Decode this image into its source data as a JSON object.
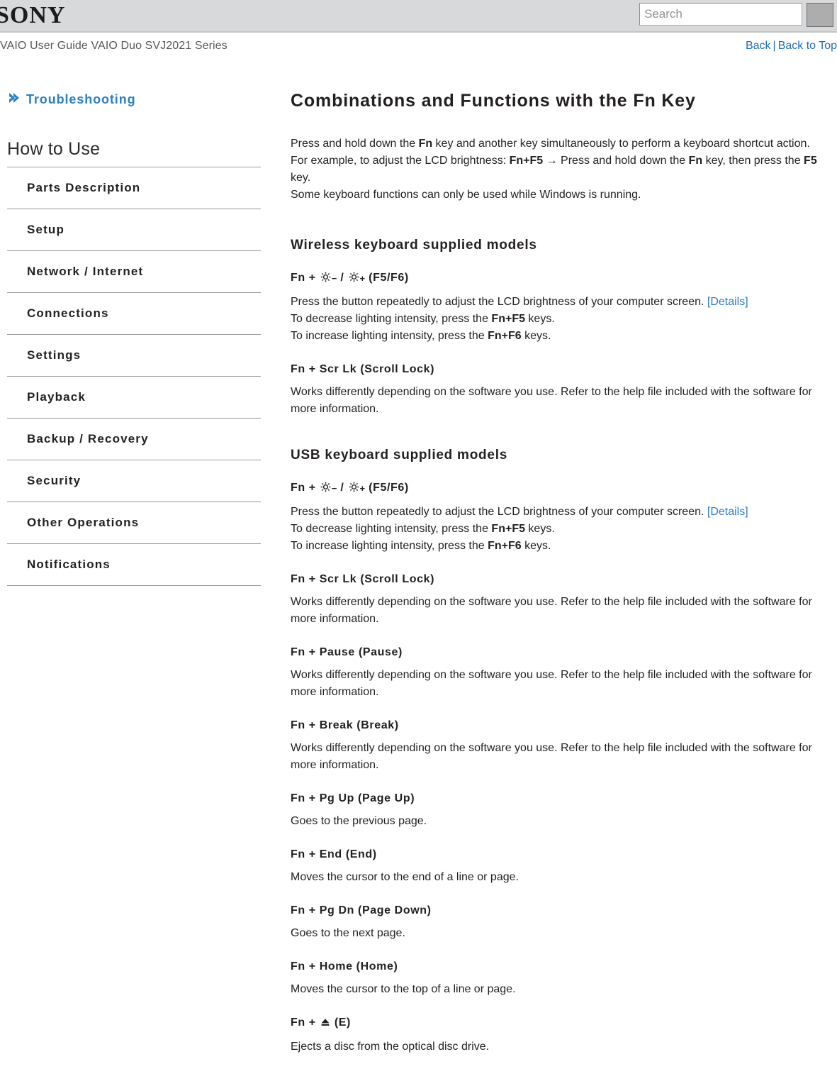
{
  "header": {
    "logo_text": "SONY",
    "search_placeholder": "Search",
    "search_value": "",
    "search_button_label": "",
    "guide_title": "VAIO User Guide VAIO Duo SVJ2021 Series",
    "back_label": "Back",
    "link_separator": "|",
    "back_to_top_label": "Back to Top"
  },
  "colors": {
    "link_blue": "#2e7ec4",
    "header_link_blue": "#1f6fb6",
    "header_gray": "#d8d9da",
    "text": "#231f20",
    "rule": "#9a9a9a"
  },
  "sidebar": {
    "breadcrumb": {
      "icon": "chevron-right-icon",
      "label": "Troubleshooting"
    },
    "section_title": "How to Use",
    "items": [
      {
        "label": "Parts Description"
      },
      {
        "label": "Setup"
      },
      {
        "label": "Network / Internet"
      },
      {
        "label": "Connections"
      },
      {
        "label": "Settings"
      },
      {
        "label": "Playback"
      },
      {
        "label": "Backup / Recovery"
      },
      {
        "label": "Security"
      },
      {
        "label": "Other Operations"
      },
      {
        "label": "Notifications"
      }
    ]
  },
  "main": {
    "title": "Combinations and Functions with the Fn Key",
    "intro": {
      "line1_a": "Press and hold down the ",
      "line1_fn": "Fn",
      "line1_b": " key and another key simultaneously to perform a keyboard shortcut action.",
      "line2_a": "For example, to adjust the LCD brightness: ",
      "line2_combo": "Fn+F5",
      "line2_b": " → Press and hold down the ",
      "line2_fn": "Fn",
      "line2_c": " key, then press the ",
      "line2_f5": "F5",
      "line2_d": " key.",
      "line3": "Some keyboard functions can only be used while Windows is running."
    },
    "sections": [
      {
        "heading": "Wireless keyboard supplied models",
        "entries": [
          {
            "type": "brightness",
            "prefix": "Fn + ",
            "icon_minus": "brightness-down-icon",
            "icon_minus_sign": "−",
            "separator": " / ",
            "icon_plus": "brightness-up-icon",
            "icon_plus_sign": "+",
            "suffix": " (F5/F6)",
            "body_a": "Press the button repeatedly to adjust the LCD brightness of your computer screen. ",
            "details_label": "[Details]",
            "body_b": "To decrease lighting intensity, press the ",
            "body_b_keys": "Fn+F5",
            "body_b_end": " keys.",
            "body_c": "To increase lighting intensity, press the ",
            "body_c_keys": "Fn+F6",
            "body_c_end": " keys."
          },
          {
            "type": "plain",
            "heading": "Fn + Scr Lk (Scroll Lock)",
            "body": "Works differently depending on the software you use. Refer to the help file included with the software for more information."
          }
        ]
      },
      {
        "heading": "USB keyboard supplied models",
        "entries": [
          {
            "type": "brightness",
            "prefix": "Fn + ",
            "icon_minus": "brightness-down-icon",
            "icon_minus_sign": "−",
            "separator": " / ",
            "icon_plus": "brightness-up-icon",
            "icon_plus_sign": "+",
            "suffix": " (F5/F6)",
            "body_a": "Press the button repeatedly to adjust the LCD brightness of your computer screen. ",
            "details_label": "[Details]",
            "body_b": "To decrease lighting intensity, press the ",
            "body_b_keys": "Fn+F5",
            "body_b_end": " keys.",
            "body_c": "To increase lighting intensity, press the ",
            "body_c_keys": "Fn+F6",
            "body_c_end": " keys."
          },
          {
            "type": "plain",
            "heading": "Fn + Scr Lk (Scroll Lock)",
            "body": "Works differently depending on the software you use. Refer to the help file included with the software for more information."
          },
          {
            "type": "plain",
            "heading": "Fn + Pause (Pause)",
            "body": "Works differently depending on the software you use. Refer to the help file included with the software for more information."
          },
          {
            "type": "plain",
            "heading": "Fn + Break (Break)",
            "body": "Works differently depending on the software you use. Refer to the help file included with the software for more information."
          },
          {
            "type": "plain",
            "heading": "Fn + Pg Up (Page Up)",
            "body": "Goes to the previous page."
          },
          {
            "type": "plain",
            "heading": "Fn + End (End)",
            "body": "Moves the cursor to the end of a line or page."
          },
          {
            "type": "plain",
            "heading": "Fn + Pg Dn (Page Down)",
            "body": "Goes to the next page."
          },
          {
            "type": "plain",
            "heading": "Fn + Home (Home)",
            "body": "Moves the cursor to the top of a line or page."
          },
          {
            "type": "eject",
            "prefix": "Fn + ",
            "icon": "eject-icon",
            "suffix": " (E)",
            "body": "Ejects a disc from the optical disc drive."
          }
        ]
      }
    ]
  }
}
